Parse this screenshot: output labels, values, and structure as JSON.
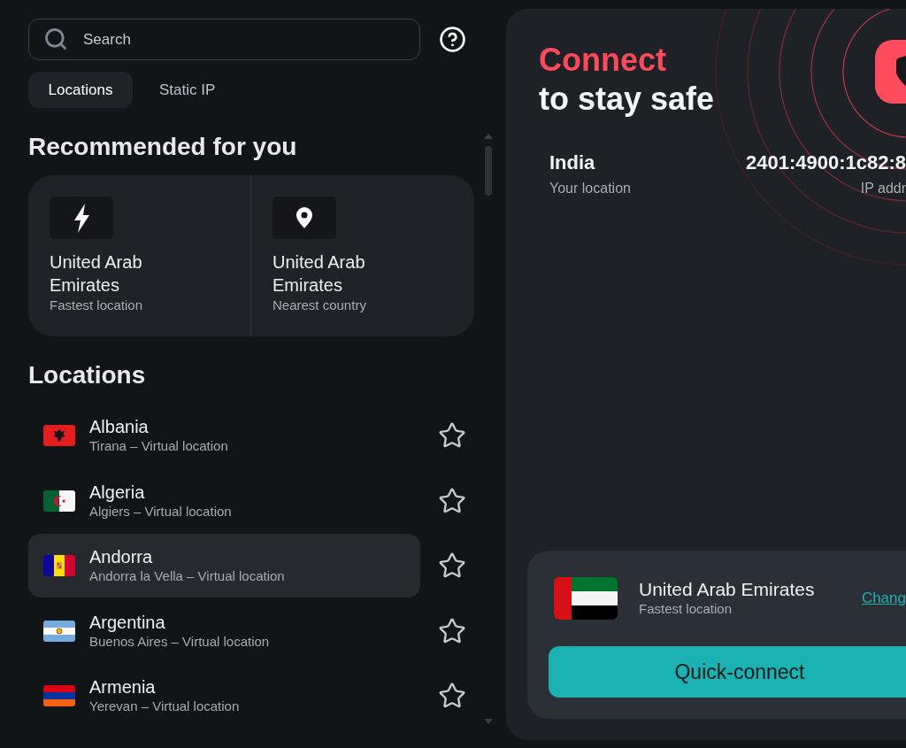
{
  "search": {
    "placeholder": "Search"
  },
  "tabs": [
    {
      "label": "Locations",
      "selected": true
    },
    {
      "label": "Static IP",
      "selected": false
    }
  ],
  "recommended": {
    "title": "Recommended for you",
    "items": [
      {
        "kind": "fastest",
        "name": "United Arab Emirates",
        "caption": "Fastest location"
      },
      {
        "kind": "nearest",
        "name": "United Arab Emirates",
        "caption": "Nearest country"
      }
    ]
  },
  "locations": {
    "title": "Locations",
    "items": [
      {
        "kind": "albania",
        "name": "Albania",
        "detail": "Tirana – Virtual location",
        "selected": false,
        "favorite": false
      },
      {
        "kind": "algeria",
        "name": "Algeria",
        "detail": "Algiers – Virtual location",
        "selected": false,
        "favorite": false
      },
      {
        "kind": "andorra",
        "name": "Andorra",
        "detail": "Andorra la Vella – Virtual location",
        "selected": true,
        "favorite": false
      },
      {
        "kind": "argentina",
        "name": "Argentina",
        "detail": "Buenos Aires – Virtual location",
        "selected": false,
        "favorite": false
      },
      {
        "kind": "armenia",
        "name": "Armenia",
        "detail": "Yerevan – Virtual location",
        "selected": false,
        "favorite": false
      }
    ]
  },
  "hero": {
    "title": "Connect",
    "subtitle": "to stay safe"
  },
  "status": [
    {
      "kind": "location",
      "value": "India",
      "label": "Your location"
    },
    {
      "kind": "ip_address",
      "value": "2401:4900:1c82:8",
      "label": "IP addr"
    }
  ],
  "quick_connect": {
    "kind": "uae",
    "name": "United Arab Emirates",
    "caption": "Fastest location",
    "link": "Chang",
    "button": "Quick-connect"
  }
}
